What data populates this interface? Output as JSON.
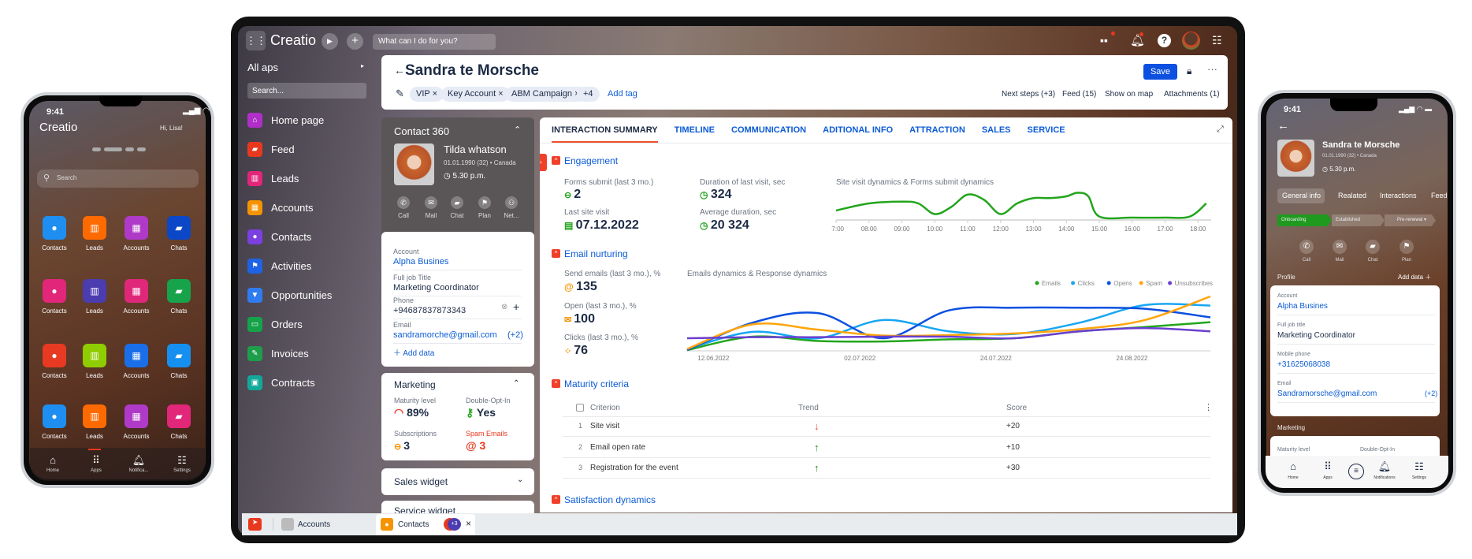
{
  "left_phone": {
    "time": "9:41",
    "logo": "Creatio",
    "greeting": "Hi, Lisa!",
    "search_placeholder": "Search",
    "apps": [
      {
        "label": "Contacts",
        "color": "#1e8ff0",
        "icon": "person-icon"
      },
      {
        "label": "Leads",
        "color": "#ff6a00",
        "icon": "leads-icon"
      },
      {
        "label": "Accounts",
        "color": "#b03ac8",
        "icon": "building-icon"
      },
      {
        "label": "Chats",
        "color": "#0c47c7",
        "icon": "chat-icon"
      },
      {
        "label": "Contacts",
        "color": "#e2267a",
        "icon": "person-icon"
      },
      {
        "label": "Leads",
        "color": "#4b3cb0",
        "icon": "leads-icon"
      },
      {
        "label": "Accounts",
        "color": "#e0287a",
        "icon": "building-icon"
      },
      {
        "label": "Chats",
        "color": "#17a34a",
        "icon": "chat-icon"
      },
      {
        "label": "Contacts",
        "color": "#e83a22",
        "icon": "person-icon"
      },
      {
        "label": "Leads",
        "color": "#8fcc00",
        "icon": "leads-icon"
      },
      {
        "label": "Accounts",
        "color": "#1a6fe8",
        "icon": "building-icon"
      },
      {
        "label": "Chats",
        "color": "#1590f0",
        "icon": "chat-icon"
      },
      {
        "label": "Contacts",
        "color": "#1e8ff0",
        "icon": "person-icon"
      },
      {
        "label": "Leads",
        "color": "#ff6a00",
        "icon": "leads-icon"
      },
      {
        "label": "Accounts",
        "color": "#b03ac8",
        "icon": "building-icon"
      },
      {
        "label": "Chats",
        "color": "#e2267a",
        "icon": "chat-icon"
      }
    ],
    "nav": [
      "Home",
      "Apps",
      "Notifica...",
      "Settings"
    ]
  },
  "topbar": {
    "logo": "Creatio",
    "search_placeholder": "What can I do for you?"
  },
  "sidebar": {
    "title": "All aps",
    "search_placeholder": "Search...",
    "items": [
      {
        "label": "Home page",
        "color": "#b02fc9"
      },
      {
        "label": "Feed",
        "color": "#e8391f"
      },
      {
        "label": "Leads",
        "color": "#e2267a"
      },
      {
        "label": "Accounts",
        "color": "#f59300"
      },
      {
        "label": "Contacts",
        "color": "#7c3fe0"
      },
      {
        "label": "Activities",
        "color": "#1e63e6"
      },
      {
        "label": "Opportunities",
        "color": "#2f7cf0"
      },
      {
        "label": "Orders",
        "color": "#15a34a"
      },
      {
        "label": "Invoices",
        "color": "#1e9e4a"
      },
      {
        "label": "Contracts",
        "color": "#12a89a"
      }
    ]
  },
  "header": {
    "back": "←",
    "title": "Sandra te Morsche",
    "tags": [
      "VIP",
      "Key Account",
      "ABM Campaign"
    ],
    "more_tags": "+4",
    "add_tag": "Add tag",
    "save": "Save",
    "links": [
      "Next steps (+3)",
      "Feed (15)",
      "Show on map",
      "Attachments (1)"
    ]
  },
  "contact360": {
    "title": "Contact 360",
    "name": "Tilda whatson",
    "dob": "01.01.1990 (32) • Canada",
    "time": "5.30 p.m.",
    "actions": [
      "Call",
      "Mail",
      "Chat",
      "Plan",
      "Net..."
    ],
    "fields": [
      {
        "label": "Account",
        "value": "Alpha Busines",
        "link": true
      },
      {
        "label": "Full job Title",
        "value": "Marketing Coordinator",
        "link": false
      },
      {
        "label": "Phone",
        "value": "+94687837873343",
        "link": false
      },
      {
        "label": "Email",
        "value": "sandramorche@gmail.com",
        "link": true,
        "extra": "(+2)"
      }
    ],
    "add_data": "Add data"
  },
  "marketing": {
    "title": "Marketing",
    "maturity_label": "Maturity level",
    "maturity": "89%",
    "optin_label": "Double-Opt-In",
    "optin": "Yes",
    "subs_label": "Subscriptions",
    "subs": "3",
    "spam_label": "Spam Emails",
    "spam": "3"
  },
  "widgets": [
    "Sales widget",
    "Service widget"
  ],
  "tabs": [
    "INTERACTION SUMMARY",
    "TIMELINE",
    "COMMUNICATION",
    "ADITIONAL INFO",
    "ATTRACTION",
    "SALES",
    "SERVICE"
  ],
  "engagement": {
    "title": "Engagement",
    "forms_label": "Forms submit (last 3 mo.)",
    "forms": "2",
    "duration_label": "Duration of last visit, sec",
    "duration": "324",
    "visit_label": "Last site visit",
    "visit": "07.12.2022",
    "avg_label": "Average duration, sec",
    "avg": "20 324"
  },
  "nurturing": {
    "title": "Email nurturing",
    "send_label": "Send emails (last 3 mo.), %",
    "send": "135",
    "open_label": "Open (last 3 mo.), %",
    "open": "100",
    "clicks_label": "Clicks (last 3 mo.), %",
    "clicks": "76"
  },
  "maturity": {
    "title": "Maturity criteria",
    "columns": [
      "Criterion",
      "Trend",
      "Score"
    ],
    "rows": [
      {
        "n": "1",
        "criterion": "Site visit",
        "trend": "down",
        "score": "+20"
      },
      {
        "n": "2",
        "criterion": "Email open rate",
        "trend": "up",
        "score": "+10"
      },
      {
        "n": "3",
        "criterion": "Registration for the event",
        "trend": "up",
        "score": "+30"
      }
    ]
  },
  "satisfaction": {
    "title": "Satisfaction dynamics"
  },
  "taskbar": {
    "tabs": [
      "Accounts",
      "Contacts"
    ],
    "badge": "+3"
  },
  "chart_data": [
    {
      "type": "line",
      "title": "Site visit dynamics & Forms submit dynamics",
      "x_ticks": [
        "07:00",
        "08:00",
        "09:00",
        "10:00",
        "11:00",
        "12:00",
        "13:00",
        "14:00",
        "15:00",
        "16:00",
        "17:00",
        "18:00"
      ],
      "series": [
        {
          "color": "#22a51c",
          "x": [
            "07:00",
            "08:00",
            "09:00",
            "09:30",
            "10:00",
            "10:30",
            "11:00",
            "11:30",
            "12:00",
            "12:30",
            "13:00",
            "13:30",
            "14:00",
            "14:20",
            "14:40",
            "15:00",
            "16:00",
            "17:00",
            "17:45",
            "18:15"
          ],
          "values": [
            2,
            4,
            4.5,
            4,
            1,
            3,
            6.5,
            5,
            1,
            4,
            5.5,
            5.5,
            6,
            7,
            6,
            0.3,
            0,
            0,
            0.3,
            4
          ]
        }
      ],
      "ylim": [
        0,
        8
      ],
      "grid": false
    },
    {
      "type": "line",
      "title": "Emails dynamics & Response dynamics",
      "x_ticks": [
        "12.06.2022",
        "02.07.2022",
        "24.07.2022",
        "24.08.2022"
      ],
      "legend": "top-right",
      "ylim": [
        0,
        100
      ],
      "grid": false,
      "series": [
        {
          "name": "Emails",
          "color": "#22a51c",
          "values": [
            0,
            25,
            17,
            16,
            20,
            22,
            35,
            43,
            52
          ]
        },
        {
          "name": "Clicks",
          "color": "#18a6f2",
          "values": [
            2,
            34,
            22,
            56,
            35,
            30,
            51,
            84,
            83
          ]
        },
        {
          "name": "Opens",
          "color": "#0b50e0",
          "values": [
            0,
            51,
            69,
            22,
            74,
            79,
            79,
            77,
            61
          ]
        },
        {
          "name": "Spam",
          "color": "#ffa50a",
          "values": [
            2,
            48,
            38,
            27,
            28,
            31,
            39,
            56,
            100
          ]
        },
        {
          "name": "Unsubscribes",
          "color": "#6a3fd0",
          "values": [
            22,
            24,
            24,
            25,
            25,
            22,
            35,
            41,
            35
          ]
        }
      ]
    }
  ],
  "right_phone": {
    "time": "9:41",
    "name": "Sandra te Morsche",
    "dob": "01.01.1990 (32) • Canada",
    "time_local": "5.30 p.m.",
    "tabs": [
      "General info",
      "Realated",
      "Interactions",
      "Feed"
    ],
    "stages": [
      "Onboarding",
      "Established",
      "Pre-renewal"
    ],
    "actions": [
      "Call",
      "Mail",
      "Chat",
      "Plan"
    ],
    "profile": "Profile",
    "add_data": "Add data",
    "fields": [
      {
        "label": "Account",
        "value": "Alpha Busines"
      },
      {
        "label": "Full job title",
        "value": "Marketing Coordinator"
      },
      {
        "label": "Mobile phone",
        "value": "+31625068038"
      },
      {
        "label": "Email",
        "value": "Sandramorsche@gmail.com",
        "extra": "(+2)"
      }
    ],
    "marketing": "Marketing",
    "maturity_label": "Maturity level",
    "optin_label": "Double-Opt-In",
    "nav": [
      "Home",
      "Apps",
      "Notifications",
      "Settings"
    ]
  }
}
